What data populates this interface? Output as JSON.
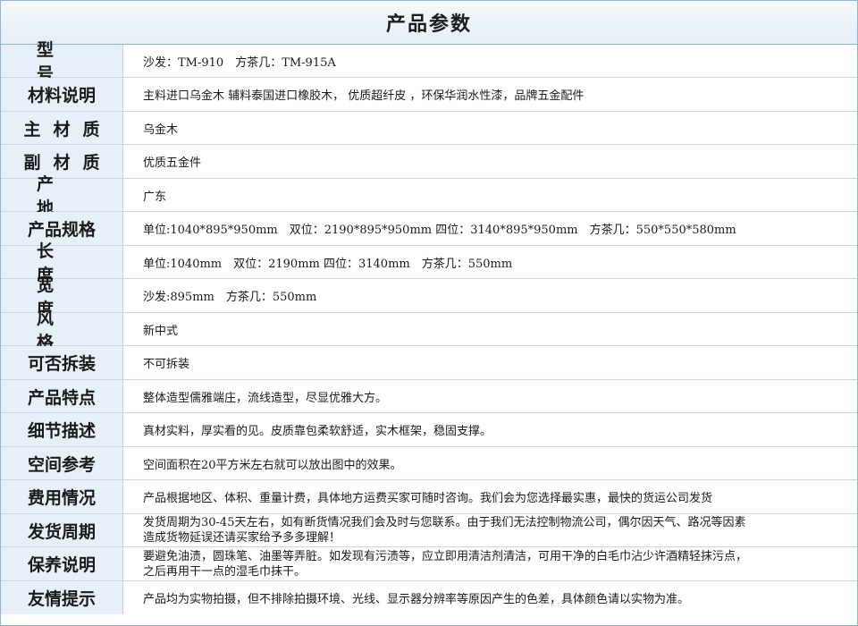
{
  "title": "产品参数",
  "rows": [
    {
      "label": "型号",
      "value": "沙发：TM-910　方茶几：TM-915A"
    },
    {
      "label": "材料说明",
      "value": "主料进口乌金木 辅料泰国进口橡胶木， 优质超纤皮 ，环保华润水性漆，品牌五金配件"
    },
    {
      "label": "主材质",
      "value": "乌金木"
    },
    {
      "label": "副材质",
      "value": "优质五金件"
    },
    {
      "label": "产地",
      "value": "广东"
    },
    {
      "label": "产品规格",
      "value": "单位:1040*895*950mm　双位：2190*895*950mm 四位：3140*895*950mm　方茶几：550*550*580mm"
    },
    {
      "label": "长度",
      "value": "单位:1040mm　双位：2190mm 四位：3140mm　方茶几：550mm"
    },
    {
      "label": "宽度",
      "value": "沙发:895mm　方茶几：550mm"
    },
    {
      "label": "风格",
      "value": "新中式"
    },
    {
      "label": "可否拆装",
      "value": "不可拆装"
    },
    {
      "label": "产品特点",
      "value": "整体造型儒雅端庄，流线造型，尽显优雅大方。"
    },
    {
      "label": "细节描述",
      "value": "真材实料，厚实看的见。皮质靠包柔软舒适，实木框架，稳固支撑。"
    },
    {
      "label": "空间参考",
      "value": "空间面积在20平方米左右就可以放出图中的效果。"
    },
    {
      "label": "费用情况",
      "value": "产品根据地区、体积、重量计费，具体地方运费买家可随时咨询。我们会为您选择最实惠，最快的货运公司发货"
    },
    {
      "label": "发货周期",
      "value_lines": [
        "发货周期为30-45天左右，如有断货情况我们会及时与您联系。由于我们无法控制物流公司，偶尔因天气、路况等因素",
        "造成货物延误还请买家给予多多理解！"
      ]
    },
    {
      "label": "保养说明",
      "value_lines": [
        "要避免油渍，圆珠笔、油墨等弄脏。如发现有污渍等，应立即用清洁剂清洁，可用干净的白毛巾沾少许酒精轻抹污点，",
        "之后再用干一点的湿毛巾抹干。"
      ]
    },
    {
      "label": "友情提示",
      "value": "产品均为实物拍摄，但不排除拍摄环境、光线、显示器分辨率等原因产生的色差，具体颜色请以实物为准。"
    }
  ]
}
